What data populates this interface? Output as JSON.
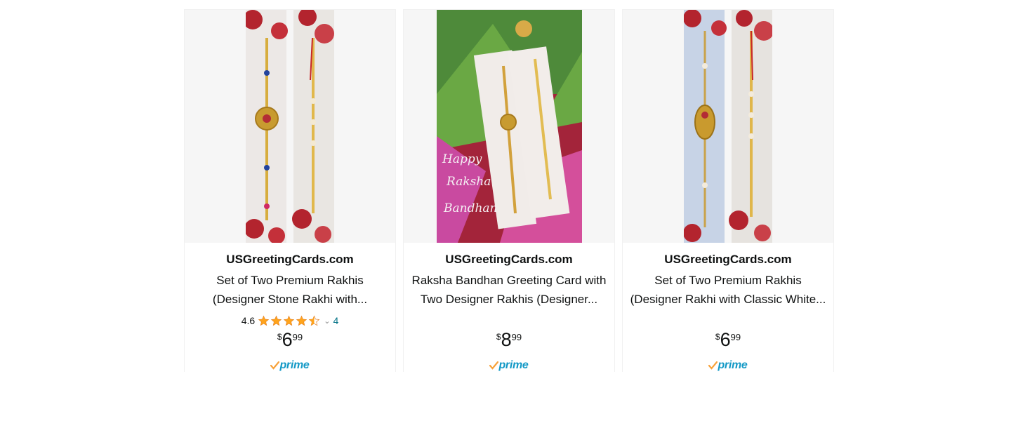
{
  "products": [
    {
      "brand": "USGreetingCards.com",
      "title_line1": "Set of Two Premium Rakhis",
      "title_line2": "(Designer Stone Rakhi with...",
      "rating": "4.6",
      "stars": 4.5,
      "review_count": "4",
      "price_symbol": "$",
      "price_whole": "6",
      "price_fraction": "99",
      "prime": "prime",
      "image_icon": "rakhi-pair-image"
    },
    {
      "brand": "USGreetingCards.com",
      "title_line1": "Raksha Bandhan Greeting Card with",
      "title_line2": "Two Designer Rakhis (Designer...",
      "price_symbol": "$",
      "price_whole": "8",
      "price_fraction": "99",
      "prime": "prime",
      "image_icon": "greeting-card-image",
      "image_text": [
        "Happy",
        "Raksha",
        "Bandhan"
      ]
    },
    {
      "brand": "USGreetingCards.com",
      "title_line1": "Set of Two Premium Rakhis",
      "title_line2": "(Designer Rakhi with Classic White...",
      "price_symbol": "$",
      "price_whole": "6",
      "price_fraction": "99",
      "prime": "prime",
      "image_icon": "rakhi-pair-image"
    }
  ],
  "colors": {
    "star": "#ffa41c",
    "link": "#007185",
    "prime_blue": "#1399c6",
    "prime_check": "#f7a23b"
  }
}
